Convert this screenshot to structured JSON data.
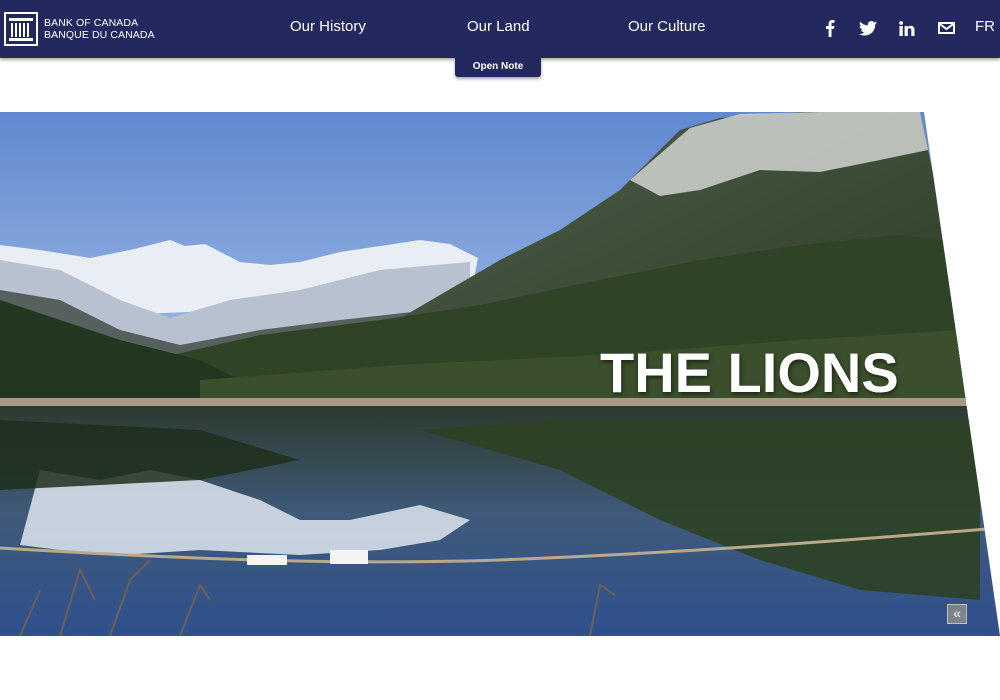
{
  "header": {
    "logo_line1": "BANK OF CANADA",
    "logo_line2": "BANQUE DU CANADA",
    "nav": [
      {
        "label": "Our History"
      },
      {
        "label": "Our Land"
      },
      {
        "label": "Our Culture"
      }
    ],
    "social": [
      "facebook-icon",
      "twitter-icon",
      "linkedin-icon",
      "mail-icon"
    ],
    "language": "FR",
    "open_note": "Open Note"
  },
  "hero": {
    "title": "THE LIONS",
    "collapse_icon": "«"
  },
  "colors": {
    "nav_bg": "#23285e",
    "text": "#ffffff"
  }
}
